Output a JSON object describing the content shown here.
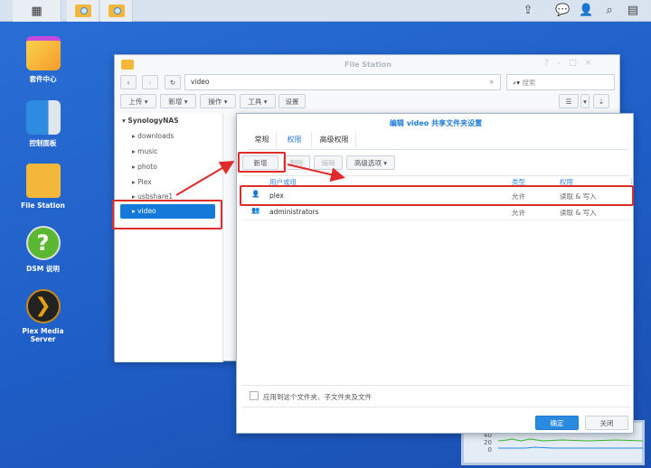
{
  "taskbar": {
    "icons": [
      "main-menu-icon",
      "file-station-icon",
      "file-station-icon"
    ],
    "tray": [
      "upload-icon",
      "chat-icon",
      "user-icon",
      "search-icon",
      "widgets-icon"
    ]
  },
  "desktop": {
    "icons": [
      {
        "label": "套件中心"
      },
      {
        "label": "控制面板"
      },
      {
        "label": "File Station"
      },
      {
        "label": "DSM 说明"
      },
      {
        "label": "Plex Media Server"
      }
    ]
  },
  "filestation": {
    "title": "File Station",
    "path": "video",
    "search_placeholder": "搜索",
    "toolbar": [
      "上传 ▾",
      "新增 ▾",
      "操作 ▾",
      "工具 ▾",
      "设置"
    ],
    "tree": {
      "root": "SynologyNAS",
      "items": [
        "downloads",
        "music",
        "photo",
        "Plex",
        "usbshare1",
        "video"
      ],
      "selected": "video"
    }
  },
  "dialog": {
    "title": "编辑 video 共享文件夹设置",
    "tabs": [
      "常规",
      "权限",
      "高级权限"
    ],
    "active_tab": "权限",
    "buttons": {
      "add": "新增",
      "delete": "删除",
      "edit": "编辑",
      "advanced": "高级选项 ▾"
    },
    "columns": [
      "用户或组",
      "类型",
      "权限"
    ],
    "rows": [
      {
        "name": "plex",
        "type": "允许",
        "perm": "读取 & 写入"
      },
      {
        "name": "administrators",
        "type": "允许",
        "perm": "读取 & 写入"
      }
    ],
    "apply_checkbox": "应用到这个文件夹、子文件夹及文件",
    "ok": "确定",
    "close": "关闭"
  },
  "widget": {
    "ticks": [
      "40",
      "20",
      "0"
    ]
  }
}
